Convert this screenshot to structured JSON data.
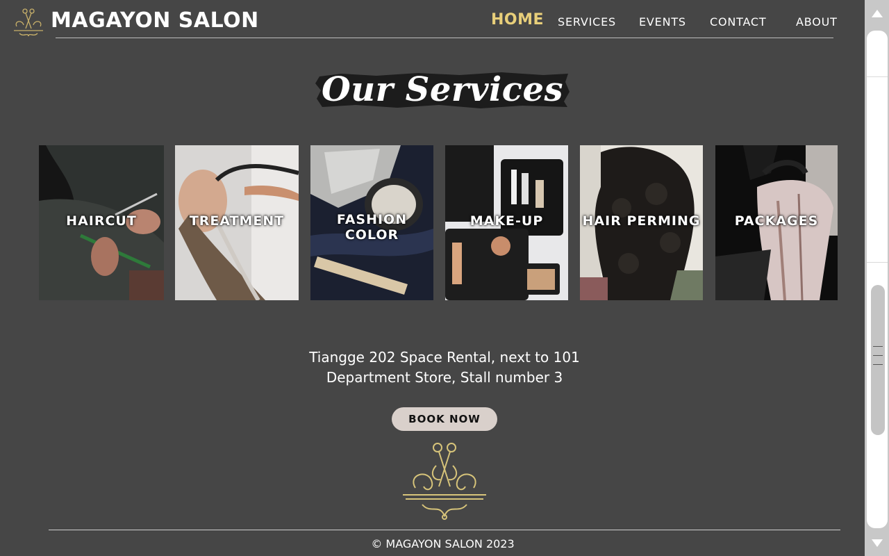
{
  "brand": {
    "name": "MAGAYON SALON",
    "logo_icon": "scissors-ornament-icon"
  },
  "nav": {
    "items": [
      {
        "label": "HOME",
        "active": true
      },
      {
        "label": "SERVICES",
        "active": false
      },
      {
        "label": "EVENTS",
        "active": false
      },
      {
        "label": "CONTACT",
        "active": false
      },
      {
        "label": "ABOUT",
        "active": false
      }
    ]
  },
  "main": {
    "title": "Our Services",
    "services": [
      {
        "label": "HAIRCUT"
      },
      {
        "label": "TREATMENT"
      },
      {
        "label": "FASHION COLOR"
      },
      {
        "label": "MAKE-UP"
      },
      {
        "label": "HAIR PERMING"
      },
      {
        "label": "PACKAGES"
      }
    ],
    "address_line1": "Tiangge 202 Space Rental, next to 101",
    "address_line2": "Department Store, Stall number 3",
    "book_label": "BOOK NOW"
  },
  "footer": {
    "copyright": "© MAGAYON SALON 2023",
    "logo_icon": "scissors-ornament-icon"
  },
  "colors": {
    "background": "#464646",
    "accent": "#e8cf7a",
    "button": "#d9d0cb"
  }
}
